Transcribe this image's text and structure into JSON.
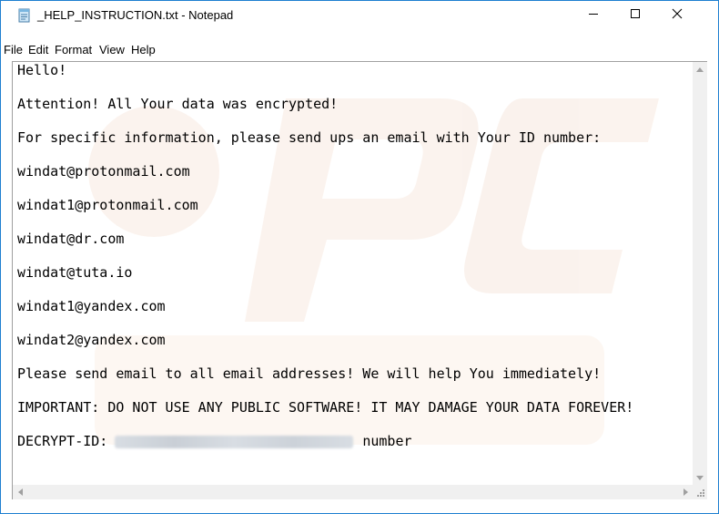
{
  "window": {
    "title": "_HELP_INSTRUCTION.txt - Notepad",
    "accent_border": "#1e7fd0"
  },
  "title_buttons": {
    "minimize_icon": "minimize-icon",
    "maximize_icon": "maximize-icon",
    "close_icon": "close-icon"
  },
  "menu": {
    "items": [
      {
        "label": "File"
      },
      {
        "label": "Edit"
      },
      {
        "label": "Format"
      },
      {
        "label": "View"
      },
      {
        "label": "Help"
      }
    ]
  },
  "editor": {
    "lines": [
      "Hello!",
      "Attention! All Your data was encrypted!",
      "For specific information, please send ups an email with Your ID number:",
      "windat@protonmail.com",
      "windat1@protonmail.com",
      "windat@dr.com",
      "windat@tuta.io",
      "windat1@yandex.com",
      "windat2@yandex.com",
      "Please send email to all email addresses! We will help You immediately!",
      "IMPORTANT: DO NOT USE ANY PUBLIC SOFTWARE! IT MAY DAMAGE YOUR DATA FOREVER!"
    ],
    "decrypt_label": "DECRYPT-ID:",
    "decrypt_suffix": "number"
  }
}
